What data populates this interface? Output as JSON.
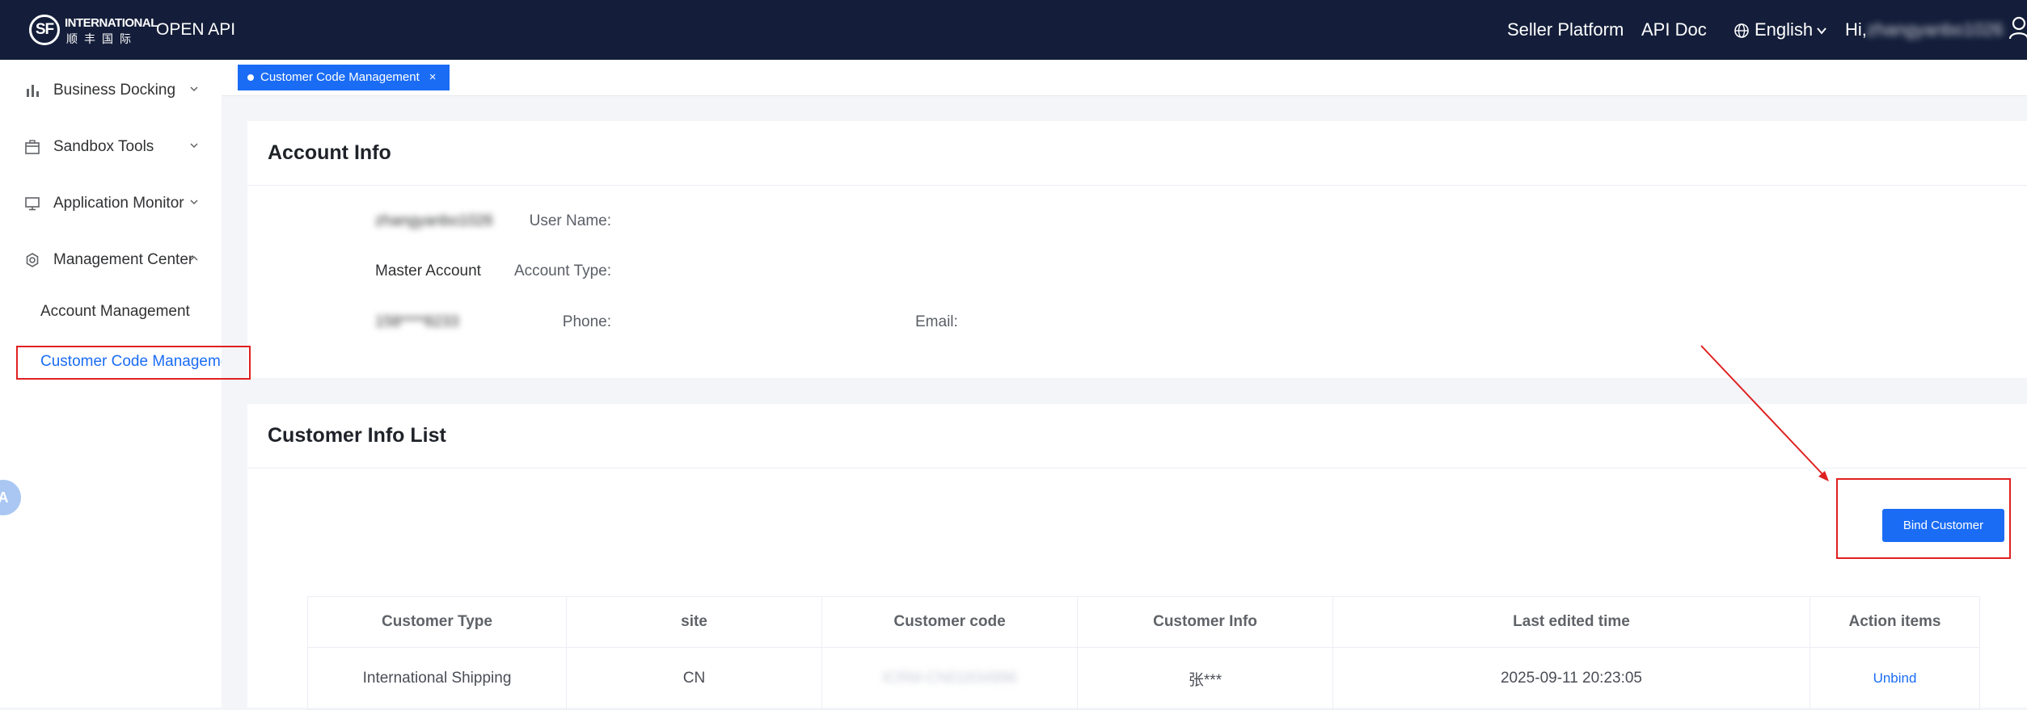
{
  "header": {
    "logo_mark": "SF",
    "logo_intl": "INTERNATIONAL",
    "logo_cn": "顺丰国际",
    "product": "OPEN API",
    "nav": [
      "Seller Platform",
      "API Doc"
    ],
    "language": "English",
    "greeting": "Hi,",
    "username": "zhangyanbo1026"
  },
  "sidebar": {
    "items": [
      {
        "label": "Business Docking",
        "icon": "bar-chart-icon"
      },
      {
        "label": "Sandbox Tools",
        "icon": "box-icon"
      },
      {
        "label": "Application Monitor",
        "icon": "monitor-icon"
      },
      {
        "label": "Management Center",
        "icon": "gear-icon"
      }
    ],
    "sub_items": [
      "Account Management",
      "Customer Code Management"
    ],
    "float_button": "A"
  },
  "tabs": [
    {
      "label": "Customer Code Management",
      "close": "×"
    }
  ],
  "account_info": {
    "title": "Account Info",
    "user_name_label": "User Name:",
    "user_name": "zhangyanbo1026",
    "account_type_label": "Account Type:",
    "account_type": "Master Account",
    "phone_label": "Phone:",
    "phone": "158****8233",
    "email_label": "Email:",
    "email": ""
  },
  "customer_list": {
    "title": "Customer Info List",
    "bind_button": "Bind Customer",
    "columns": [
      "Customer Type",
      "site",
      "Customer code",
      "Customer Info",
      "Last edited time",
      "Action items"
    ],
    "rows": [
      {
        "type": "International Shipping",
        "site": "CN",
        "code": "ICRM-CN01834996",
        "info": "张***",
        "edited": "2025-09-11 20:23:05",
        "action": "Unbind"
      }
    ]
  },
  "colors": {
    "header_bg": "#141e3a",
    "accent": "#1a6cf5",
    "annotation": "#e02020"
  }
}
